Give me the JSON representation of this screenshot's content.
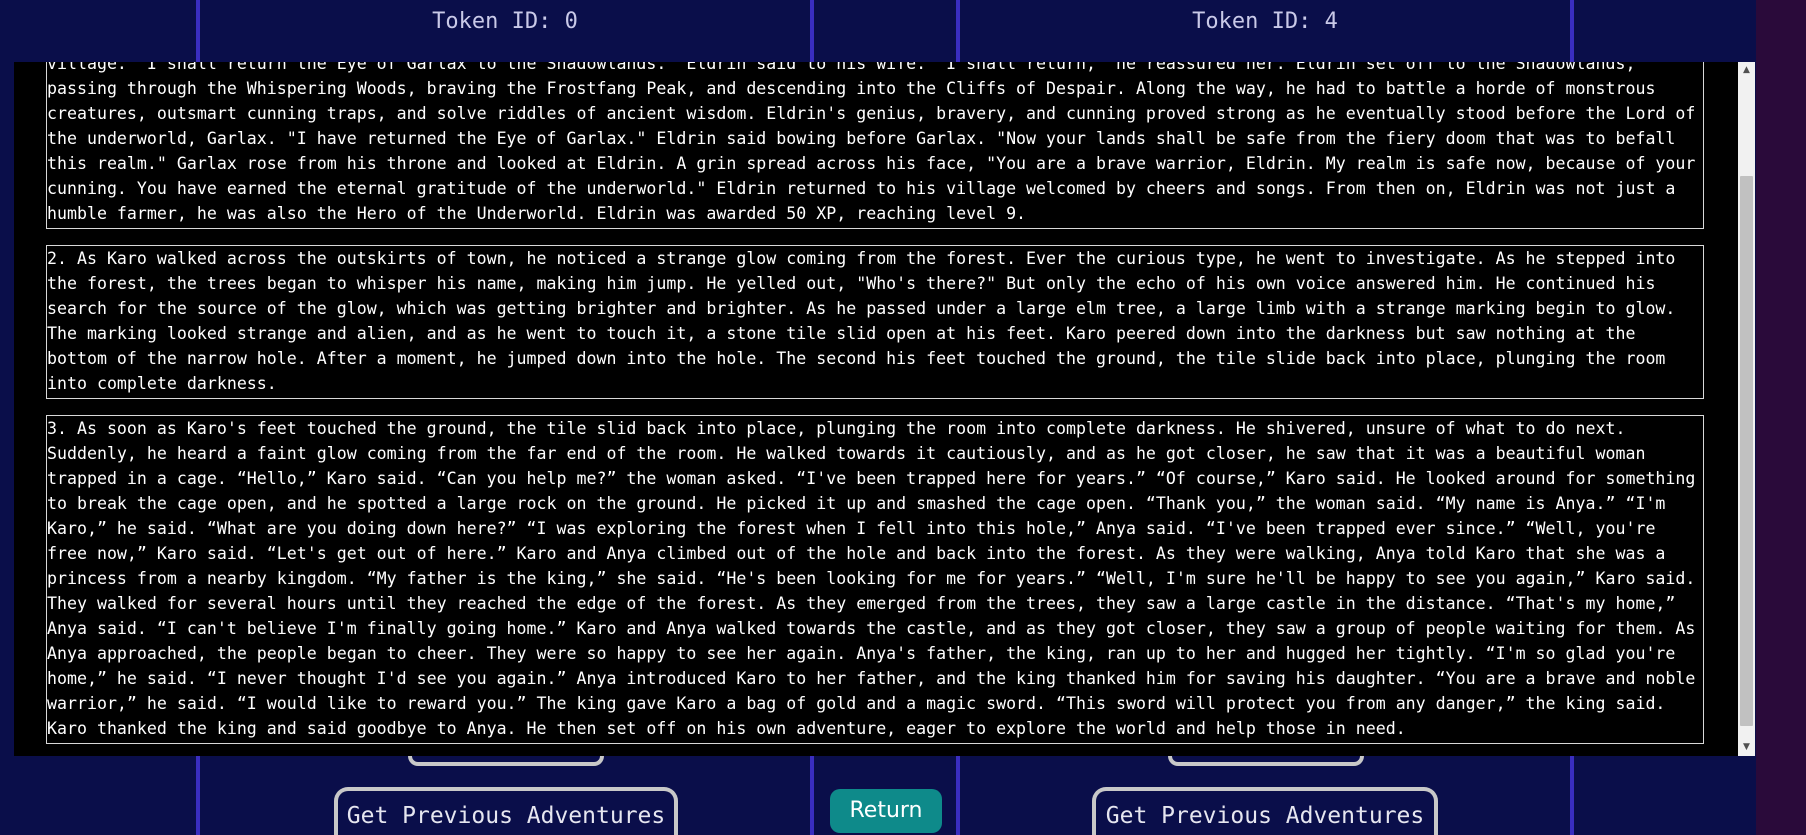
{
  "header": {
    "token_left": "Token ID: 0",
    "token_right": "Token ID: 4"
  },
  "stories": [
    "village. \"I shall return the Eye of Garlax to the Shadowlands.\" Eldrin said to his wife. \"I shall return,\" he reassured her. Eldrin set off to the Shadowlands, passing through the Whispering Woods, braving the Frostfang Peak, and descending into the Cliffs of Despair. Along the way, he had to battle a horde of monstrous creatures, outsmart cunning traps, and solve riddles of ancient wisdom. Eldrin's genius, bravery, and cunning proved strong as he eventually stood before the Lord of the underworld, Garlax. \"I have returned the Eye of Garlax.\" Eldrin said bowing before Garlax. \"Now your lands shall be safe from the fiery doom that was to befall this realm.\" Garlax rose from his throne and looked at Eldrin. A grin spread across his face, \"You are a brave warrior, Eldrin. My realm is safe now, because of your cunning. You have earned the eternal gratitude of the underworld.\" Eldrin returned to his village welcomed by cheers and songs. From then on, Eldrin was not just a humble farmer, he was also the Hero of the Underworld. Eldrin was awarded 50 XP, reaching level 9.",
    "2. As Karo walked across the outskirts of town, he noticed a strange glow coming from the forest. Ever the curious type, he went to investigate. As he stepped into the forest, the trees began to whisper his name, making him jump. He yelled out, \"Who's there?\" But only the echo of his own voice answered him. He continued his search for the source of the glow, which was getting brighter and brighter. As he passed under a large elm tree, a large limb with a strange marking begin to glow. The marking looked strange and alien, and as he went to touch it, a stone tile slid open at his feet. Karo peered down into the darkness but saw nothing at the bottom of the narrow hole. After a moment, he jumped down into the hole. The second his feet touched the ground, the tile slide back into place, plunging the room into complete darkness.",
    "3. As soon as Karo's feet touched the ground, the tile slid back into place, plunging the room into complete darkness. He shivered, unsure of what to do next. Suddenly, he heard a faint glow coming from the far end of the room. He walked towards it cautiously, and as he got closer, he saw that it was a beautiful woman trapped in a cage. “Hello,” Karo said. “Can you help me?” the woman asked. “I've been trapped here for years.” “Of course,” Karo said. He looked around for something to break the cage open, and he spotted a large rock on the ground. He picked it up and smashed the cage open. “Thank you,” the woman said. “My name is Anya.” “I'm Karo,” he said. “What are you doing down here?” “I was exploring the forest when I fell into this hole,” Anya said. “I've been trapped ever since.” “Well, you're free now,” Karo said. “Let's get out of here.” Karo and Anya climbed out of the hole and back into the forest. As they were walking, Anya told Karo that she was a princess from a nearby kingdom. “My father is the king,” she said. “He's been looking for me for years.” “Well, I'm sure he'll be happy to see you again,” Karo said. They walked for several hours until they reached the edge of the forest. As they emerged from the trees, they saw a large castle in the distance. “That's my home,” Anya said. “I can't believe I'm finally going home.” Karo and Anya walked towards the castle, and as they got closer, they saw a group of people waiting for them. As Anya approached, the people began to cheer. They were so happy to see her again. Anya's father, the king, ran up to her and hugged her tightly. “I'm so glad you're home,” he said. “I never thought I'd see you again.” Anya introduced Karo to her father, and the king thanked him for saving his daughter. “You are a brave and noble warrior,” he said. “I would like to reward you.” The king gave Karo a bag of gold and a magic sword. “This sword will protect you from any danger,” the king said. Karo thanked the king and said goodbye to Anya. He then set off on his own adventure, eager to explore the world and help those in need."
  ],
  "footer": {
    "prev_left": "Get Previous Adventures",
    "prev_right": "Get Previous Adventures",
    "return": "Return"
  },
  "icons": {
    "scroll_up": "up-arrow-icon",
    "scroll_down": "down-arrow-icon"
  },
  "colors": {
    "background": "#0a0e4a",
    "panel": "#000000",
    "column_line": "#3a2ec0",
    "return_button": "#0e8a8a"
  }
}
